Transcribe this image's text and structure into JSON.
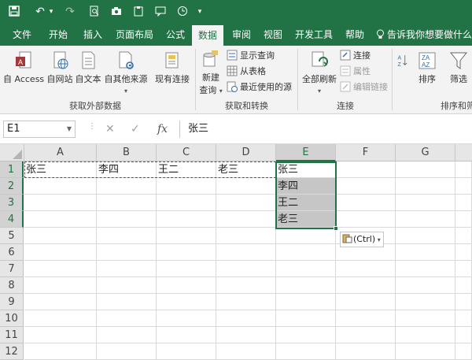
{
  "qat": {
    "save": "💾",
    "undo": "↶",
    "redo": "↷",
    "more": "▾"
  },
  "tabs": [
    "文件",
    "开始",
    "插入",
    "页面布局",
    "公式",
    "数据",
    "审阅",
    "视图",
    "开发工具",
    "帮助"
  ],
  "active_tab": "数据",
  "tellme": "告诉我你想要做什么",
  "ribbon": {
    "external": {
      "buttons": [
        "自 Access",
        "自网站",
        "自文本",
        "自其他来源",
        "现有连接"
      ],
      "label": "获取外部数据"
    },
    "transform": {
      "new_query": [
        "新建",
        "查询"
      ],
      "items": [
        "显示查询",
        "从表格",
        "最近使用的源"
      ],
      "label": "获取和转换"
    },
    "connections": {
      "refresh": [
        "全部刷新"
      ],
      "items": [
        "连接",
        "属性",
        "编辑链接"
      ],
      "label": "连接"
    },
    "sort": {
      "items": [
        "排序",
        "筛选"
      ],
      "label": "排序和筛"
    }
  },
  "formula_bar": {
    "name_box": "E1",
    "cancel": "✕",
    "enter": "✓",
    "fx": "fx",
    "value": "张三"
  },
  "columns": [
    "A",
    "B",
    "C",
    "D",
    "E",
    "F",
    "G"
  ],
  "rows": [
    "1",
    "2",
    "3",
    "4",
    "5",
    "6",
    "7",
    "8",
    "9",
    "10",
    "11",
    "12"
  ],
  "cells": {
    "A1": "张三",
    "B1": "李四",
    "C1": "王二",
    "D1": "老三",
    "E1": "张三",
    "E2": "李四",
    "E3": "王二",
    "E4": "老三"
  },
  "paste_options": "(Ctrl)"
}
